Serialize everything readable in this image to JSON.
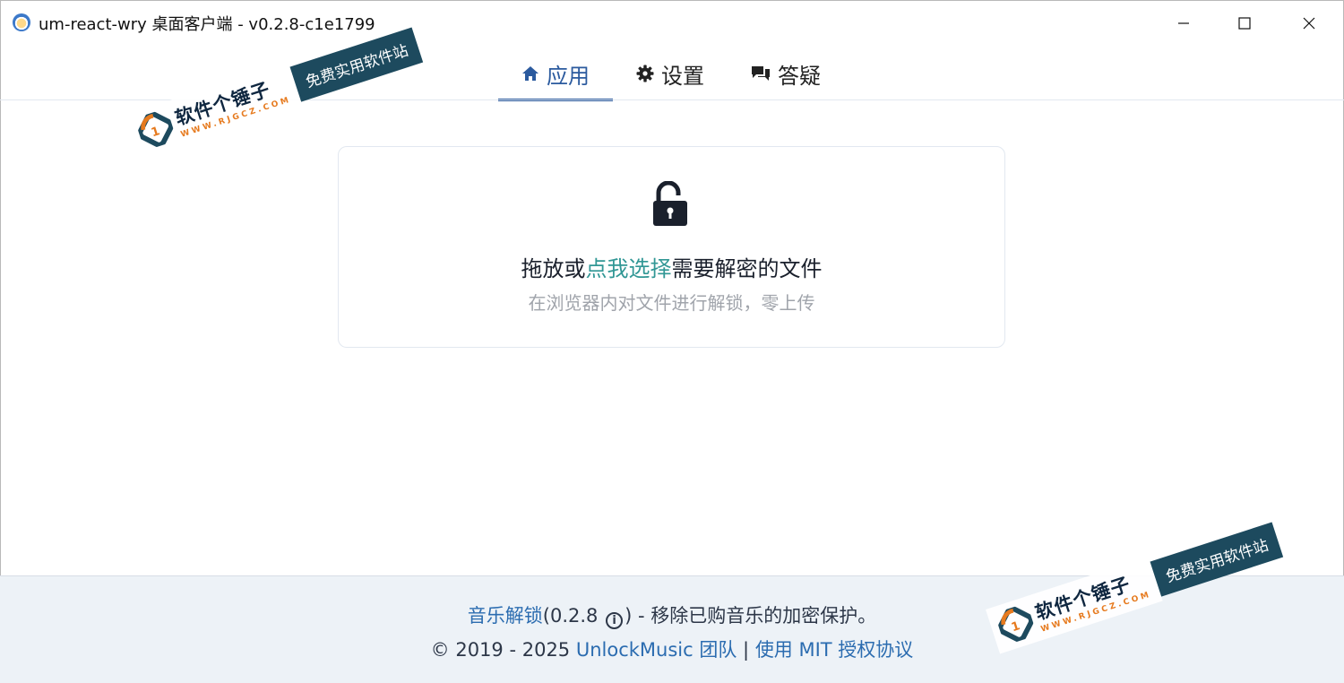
{
  "window": {
    "title": "um-react-wry 桌面客户端 - v0.2.8-c1e1799"
  },
  "tabs": [
    {
      "label": "应用",
      "icon": "home-icon",
      "active": true
    },
    {
      "label": "设置",
      "icon": "gear-icon",
      "active": false
    },
    {
      "label": "答疑",
      "icon": "chat-icon",
      "active": false
    }
  ],
  "dropzone": {
    "icon": "unlock-icon",
    "text_before": "拖放或",
    "link_text": "点我选择",
    "text_after": "需要解密的文件",
    "subtitle": "在浏览器内对文件进行解锁，零上传"
  },
  "footer": {
    "app_link": "音乐解锁",
    "version": "(0.2.8",
    "info_icon": "i",
    "description": ") - 移除已购音乐的加密保护。",
    "copyright": "© 2019 - 2025",
    "team_link": "UnlockMusic 团队",
    "separator": "|",
    "license_link": "使用 MIT 授权协议"
  },
  "watermark": {
    "main_text": "软件个锤子",
    "url_text": "WWW.RJGCZ.COM",
    "tag_text": "免费实用软件站"
  },
  "colors": {
    "accent": "#2b5a9e",
    "link_teal": "#319795",
    "link_blue": "#2b6cb0",
    "footer_bg": "#edf2f7"
  }
}
